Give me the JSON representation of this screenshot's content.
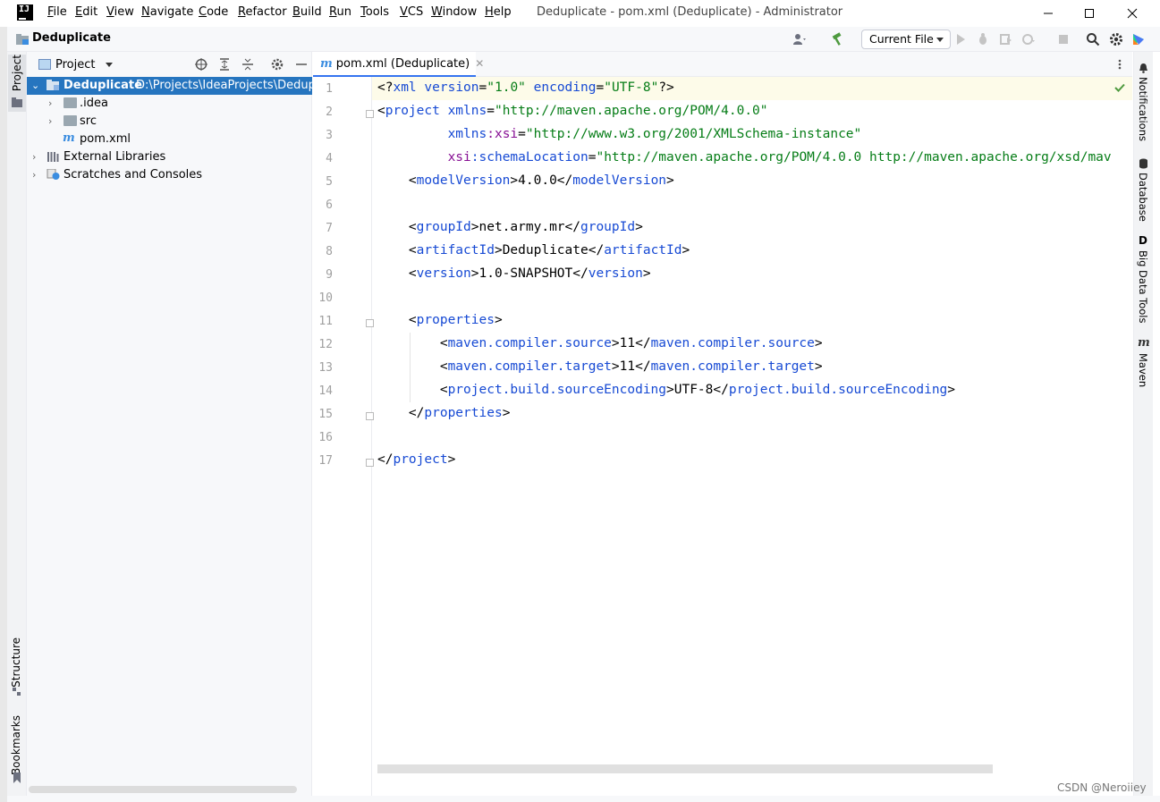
{
  "menubar": {
    "items": [
      "File",
      "Edit",
      "View",
      "Navigate",
      "Code",
      "Refactor",
      "Build",
      "Run",
      "Tools",
      "VCS",
      "Window",
      "Help"
    ]
  },
  "window_title": "Deduplicate - pom.xml (Deduplicate) - Administrator",
  "logo_text": "IJ",
  "navbar": {
    "project_name": "Deduplicate",
    "run_config": "Current File"
  },
  "left_strip": {
    "project": "Project",
    "structure": "Structure",
    "bookmarks": "Bookmarks"
  },
  "project_panel": {
    "title": "Project",
    "tree": {
      "root_name": "Deduplicate",
      "root_path": "D:\\Projects\\IdeaProjects\\Deduplica",
      "idea": ".idea",
      "src": "src",
      "pom": "pom.xml",
      "external_libraries": "External Libraries",
      "scratches": "Scratches and Consoles"
    }
  },
  "editor": {
    "tab_label": "pom.xml (Deduplicate)",
    "line_numbers": [
      "1",
      "2",
      "3",
      "4",
      "5",
      "6",
      "7",
      "8",
      "9",
      "10",
      "11",
      "12",
      "13",
      "14",
      "15",
      "16",
      "17"
    ],
    "code": {
      "l1": {
        "p1": "<?",
        "p2": "xml",
        "p3": " version",
        "p4": "=",
        "p5": "\"1.0\"",
        "p6": " encoding",
        "p7": "=",
        "p8": "\"UTF-8\"",
        "p9": "?>"
      },
      "l2": {
        "p1": "<",
        "p2": "project",
        "p3": " xmlns",
        "p4": "=",
        "p5": "\"http://maven.apache.org/POM/4.0.0\""
      },
      "l3": {
        "p1": "         ",
        "p2": "xmlns",
        "p3": ":xsi",
        "p4": "=",
        "p5": "\"http://www.w3.org/2001/XMLSchema-instance\""
      },
      "l4": {
        "p1": "         ",
        "p2": "xsi",
        "p3": ":schemaLocation",
        "p4": "=",
        "p5": "\"http://maven.apache.org/POM/4.0.0 http://maven.apache.org/xsd/mav"
      },
      "l5": {
        "p1": "    <",
        "p2": "modelVersion",
        "p3": ">4.0.0</",
        "p4": "modelVersion",
        "p5": ">"
      },
      "l7": {
        "p1": "    <",
        "p2": "groupId",
        "p3": ">net.army.mr</",
        "p4": "groupId",
        "p5": ">"
      },
      "l8": {
        "p1": "    <",
        "p2": "artifactId",
        "p3": ">Deduplicate</",
        "p4": "artifactId",
        "p5": ">"
      },
      "l9": {
        "p1": "    <",
        "p2": "version",
        "p3": ">1.0-SNAPSHOT</",
        "p4": "version",
        "p5": ">"
      },
      "l11": {
        "p1": "    <",
        "p2": "properties",
        "p3": ">"
      },
      "l12": {
        "p1": "        <",
        "p2": "maven.compiler.source",
        "p3": ">11</",
        "p4": "maven.compiler.source",
        "p5": ">"
      },
      "l13": {
        "p1": "        <",
        "p2": "maven.compiler.target",
        "p3": ">11</",
        "p4": "maven.compiler.target",
        "p5": ">"
      },
      "l14": {
        "p1": "        <",
        "p2": "project.build.sourceEncoding",
        "p3": ">UTF-8</",
        "p4": "project.build.sourceEncoding",
        "p5": ">"
      },
      "l15": {
        "p1": "    </",
        "p2": "properties",
        "p3": ">"
      },
      "l17": {
        "p1": "</",
        "p2": "project",
        "p3": ">"
      }
    }
  },
  "right_strip": {
    "notifications": "Notifications",
    "database": "Database",
    "big_data_tools": "Big Data Tools",
    "maven": "Maven"
  },
  "watermark": "CSDN @Neroiiey",
  "colors": {
    "selection": "#2675bf",
    "tag": "#174ad4",
    "namespace": "#871094",
    "string": "#067d17"
  }
}
